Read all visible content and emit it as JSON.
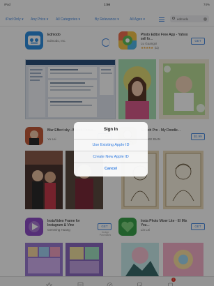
{
  "status": {
    "device": "iPad",
    "time": "1:56",
    "battery": "74%"
  },
  "filters": [
    "iPad Only ▾",
    "Any Price ▾",
    "All Categories ▾",
    "By Relevance ▾",
    "All Ages ▾"
  ],
  "search": {
    "query": "edmodo"
  },
  "apps": [
    {
      "name": "Edmodo",
      "developer": "Edmodo, Inc."
    },
    {
      "name": "Photo Editor Free App - Yahoo sell fo...",
      "developer": "Lu Guangxi",
      "stars": "★★★★★",
      "count": "(11)",
      "button": "GET"
    },
    {
      "name": "Blur Effect sky - Bokeh Focus...",
      "developer": "Yu Lei",
      "button": "$1.99"
    },
    {
      "name": "Sketch Pro - My Doodle...",
      "developer": "ZHU KE BIAN",
      "button": "$1.99"
    },
    {
      "name": "InstaVideo Frame for Instagram & Vine",
      "developer": "Genming Huang",
      "button": "GET",
      "sub": "In-App Purchases"
    },
    {
      "name": "Insta Photo Mixer Lite - El Mix You...",
      "developer": "Lin Lei",
      "button": "GET"
    }
  ],
  "alert": {
    "title": "Sign In",
    "option1": "Use Existing Apple ID",
    "option2": "Create New Apple ID",
    "cancel": "Cancel"
  },
  "tabbar": {
    "badge": "1"
  },
  "colors": {
    "accent": "#4a8be0",
    "link": "#2f7be0",
    "badge": "#e0362c"
  }
}
